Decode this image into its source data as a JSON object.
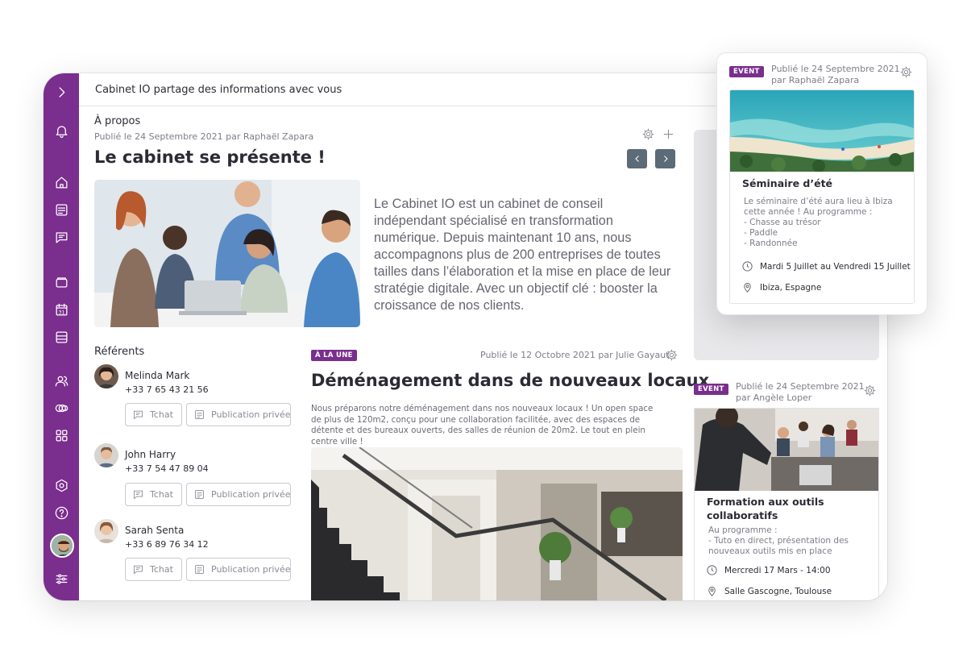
{
  "topbar": {
    "title": "Cabinet IO partage des informations avec vous"
  },
  "sidebar": {
    "items": [
      {
        "icon": "chevron-right-icon"
      },
      {
        "icon": "bell-icon"
      },
      {
        "icon": "home-icon"
      },
      {
        "icon": "news-icon"
      },
      {
        "icon": "chat-icon"
      },
      {
        "icon": "folder-icon"
      },
      {
        "icon": "calendar-icon",
        "label": "31"
      },
      {
        "icon": "list-icon"
      },
      {
        "icon": "users-icon"
      },
      {
        "icon": "link-circles-icon"
      },
      {
        "icon": "apps-grid-icon"
      },
      {
        "icon": "hexagon-settings-icon"
      },
      {
        "icon": "help-icon"
      },
      {
        "icon": "sliders-icon"
      }
    ]
  },
  "about": {
    "section": "À propos",
    "meta": "Publié le 24 Septembre 2021 par Raphaël Zapara",
    "title": "Le cabinet se présente !",
    "text": "Le Cabinet IO est un cabinet de conseil indépendant spécialisé en transformation numérique. Depuis maintenant 10 ans, nous accompagnons plus de 200 entreprises de toutes tailles dans l’élaboration et la mise en place de leur stratégie digitale. Avec un objectif clé : booster la croissance de nos clients."
  },
  "referents": {
    "heading": "Référents",
    "chat_label": "Tchat",
    "private_label": "Publication privée",
    "people": [
      {
        "name": "Melinda Mark",
        "phone": "+33 7 65 43 21 56"
      },
      {
        "name": "John Harry",
        "phone": "+33 7 54 47 89 04"
      },
      {
        "name": "Sarah Senta",
        "phone": "+33 6 89 76 34 12"
      }
    ]
  },
  "feed": {
    "badge": "À LA UNE",
    "meta": "Publié le 12 Octobre 2021 par Julie Gayaut",
    "title": "Déménagement dans de nouveaux locaux",
    "text": "Nous préparons notre déménagement dans nos nouveaux locaux ! Un open space de plus de 120m2, conçu pour une collaboration facilitée, avec des espaces de détente et des bureaux ouverts, des salles de réunion de 20m2. Le tout en plein centre ville !"
  },
  "event_popup": {
    "badge": "EVENT",
    "meta_line1": "Publié le 24 Septembre 2021",
    "meta_line2": "par Raphaël Zapara",
    "title": "Séminaire d’été",
    "text": "Le séminaire d’été aura lieu à Ibiza\ncette année ! Au programme :\n- Chasse au trésor\n- Paddle\n- Randonnée",
    "date": "Mardi 5 Juillet au Vendredi 15 Juillet",
    "place": "Ibiza, Espagne"
  },
  "event_card": {
    "badge": "EVENT",
    "meta_line1": "Publié le 24 Septembre 2021",
    "meta_line2": "par Angèle Loper",
    "title_line1": "Formation aux outils",
    "title_line2": "collaboratifs",
    "text": "Au programme :\n- Tuto en direct, présentation des\nnouveaux outils mis en place",
    "date": "Mercredi 17 Mars - 14:00",
    "place": "Salle Gascogne, Toulouse"
  },
  "colors": {
    "brand": "#7a2e8e",
    "nav_button": "#5b6b77"
  }
}
